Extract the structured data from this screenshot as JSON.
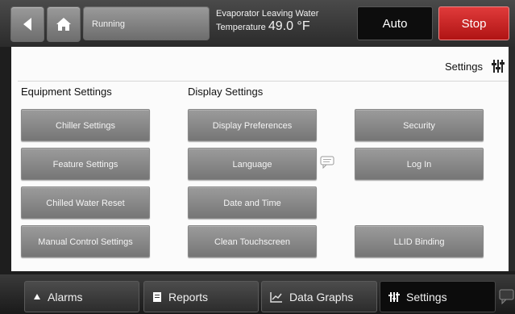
{
  "topbar": {
    "status": "Running",
    "evap_line1": "Evaporator Leaving Water",
    "evap_line2_label": "Temperature",
    "evap_value": "49.0 °F",
    "auto_label": "Auto",
    "stop_label": "Stop",
    "stop_color": "#c81e1e"
  },
  "panel": {
    "header_title": "Settings",
    "equipment": {
      "title": "Equipment Settings",
      "buttons": [
        "Chiller Settings",
        "Feature Settings",
        "Chilled Water Reset",
        "Manual Control Settings"
      ]
    },
    "display": {
      "title": "Display Settings",
      "buttons": [
        "Display Preferences",
        "Language",
        "Date and Time",
        "Clean Touchscreen"
      ]
    },
    "other": {
      "buttons": [
        "Security",
        "Log In",
        "LLID Binding"
      ]
    }
  },
  "tabs": [
    "Alarms",
    "Reports",
    "Data Graphs",
    "Settings"
  ],
  "icons": [
    "back-arrow-icon",
    "home-icon",
    "settings-sliders-icon",
    "chat-bubble-icon",
    "alarm-bell-icon",
    "report-document-icon",
    "chart-icon"
  ]
}
